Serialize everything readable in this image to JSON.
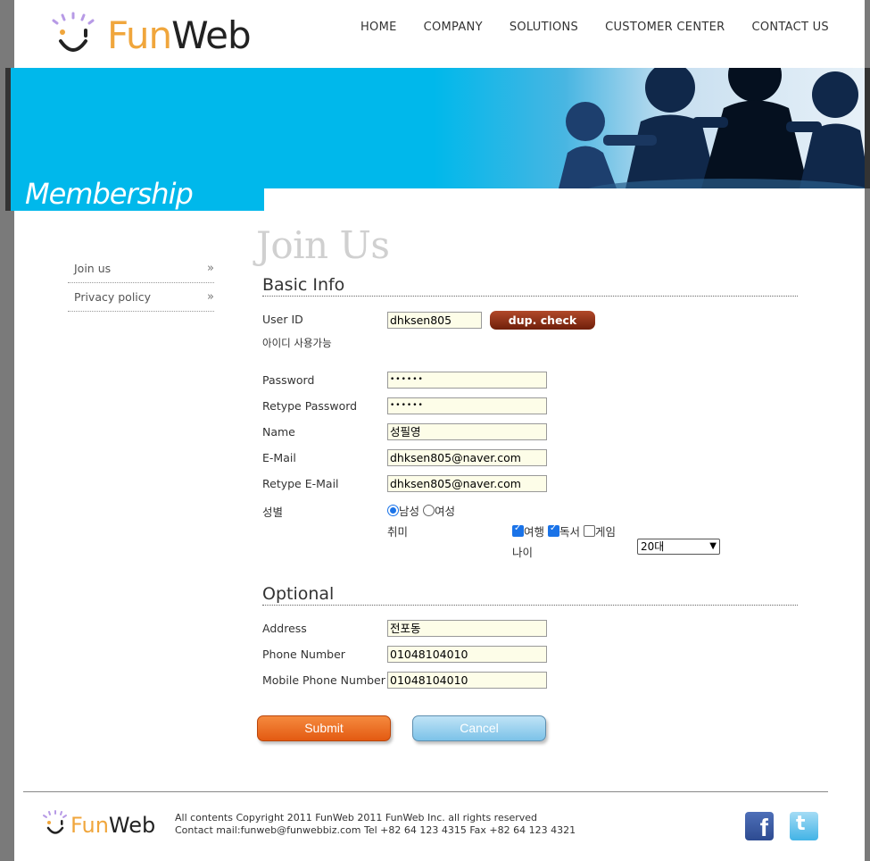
{
  "header": {
    "logo_part1": "Fun",
    "logo_part2": "Web",
    "nav": [
      "HOME",
      "COMPANY",
      "SOLUTIONS",
      "CUSTOMER CENTER",
      "CONTACT US"
    ]
  },
  "banner": {
    "title": "Membership"
  },
  "sidebar": {
    "items": [
      {
        "label": "Join us",
        "arrow": "»"
      },
      {
        "label": "Privacy policy",
        "arrow": "»"
      }
    ]
  },
  "main": {
    "page_title": "Join Us",
    "basic_info": {
      "heading": "Basic Info",
      "user_id_label": "User ID",
      "user_id_value": "dhksen805",
      "dup_check_label": "dup. check",
      "id_status_text": "아이디 사용가능",
      "password_label": "Password",
      "password_value": "••••••",
      "retype_password_label": "Retype Password",
      "retype_password_value": "••••••",
      "name_label": "Name",
      "name_value": "성필영",
      "email_label": "E-Mail",
      "email_value": "dhksen805@naver.com",
      "retype_email_label": "Retype E-Mail",
      "retype_email_value": "dhksen805@naver.com",
      "gender_label": "성별",
      "gender_options": [
        "남성",
        "여성"
      ],
      "gender_selected": "남성",
      "hobby_label": "취미",
      "hobby_options": [
        {
          "label": "여행",
          "checked": true
        },
        {
          "label": "독서",
          "checked": true
        },
        {
          "label": "게임",
          "checked": false
        }
      ],
      "age_label": "나이",
      "age_value": "20대"
    },
    "optional": {
      "heading": "Optional",
      "address_label": "Address",
      "address_value": "전포동",
      "phone_label": "Phone Number",
      "phone_value": "01048104010",
      "mobile_label": "Mobile Phone Number",
      "mobile_value": "01048104010"
    },
    "buttons": {
      "submit": "Submit",
      "cancel": "Cancel"
    }
  },
  "footer": {
    "logo_part1": "Fun",
    "logo_part2": "Web",
    "copyright": "All contents Copyright 2011 FunWeb 2011 FunWeb Inc. all rights reserved",
    "contact": "Contact mail:funweb@funwebbiz.com Tel +82 64 123 4315 Fax +82 64 123 4321",
    "social": [
      "facebook-icon",
      "twitter-icon"
    ]
  },
  "colors": {
    "brand_orange": "#f0a63c",
    "banner_blue": "#00b8eb",
    "dup_button": "#8b2a12",
    "submit": "#e96a20",
    "cancel": "#9fd3ef",
    "input_bg": "#fdfde8"
  }
}
